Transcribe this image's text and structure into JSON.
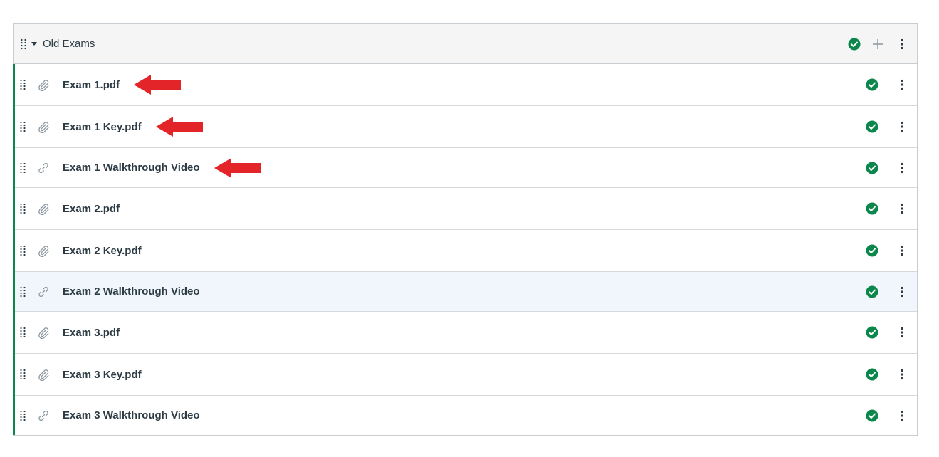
{
  "module": {
    "title": "Old Exams",
    "accent_color": "#0b874b",
    "items": [
      {
        "title": "Exam 1.pdf",
        "type_icon": "paperclip-icon",
        "kind": "attachment",
        "published": true,
        "annotated": true
      },
      {
        "title": "Exam 1 Key.pdf",
        "type_icon": "paperclip-icon",
        "kind": "attachment",
        "published": true,
        "annotated": true
      },
      {
        "title": "Exam 1 Walkthrough Video",
        "type_icon": "link-icon",
        "kind": "external-link",
        "published": true,
        "annotated": true
      },
      {
        "title": "Exam 2.pdf",
        "type_icon": "paperclip-icon",
        "kind": "attachment",
        "published": true,
        "annotated": false
      },
      {
        "title": "Exam 2 Key.pdf",
        "type_icon": "paperclip-icon",
        "kind": "attachment",
        "published": true,
        "annotated": false
      },
      {
        "title": "Exam 2 Walkthrough Video",
        "type_icon": "link-icon",
        "kind": "external-link",
        "published": true,
        "annotated": false,
        "hovered": true
      },
      {
        "title": "Exam 3.pdf",
        "type_icon": "paperclip-icon",
        "kind": "attachment",
        "published": true,
        "annotated": false
      },
      {
        "title": "Exam 3 Key.pdf",
        "type_icon": "paperclip-icon",
        "kind": "attachment",
        "published": true,
        "annotated": false
      },
      {
        "title": "Exam 3 Walkthrough Video",
        "type_icon": "link-icon",
        "kind": "external-link",
        "published": true,
        "annotated": false
      }
    ]
  },
  "colors": {
    "published_green": "#0b874b",
    "annotation_red": "#e32428",
    "hover_row": "#f0f6fc",
    "header_bg": "#f5f5f5"
  }
}
